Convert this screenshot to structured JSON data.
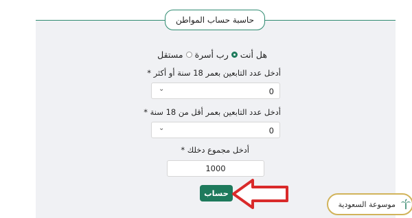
{
  "form": {
    "title": "حاسبة حساب المواطن",
    "question": "هل أنت",
    "options": [
      {
        "label": "رب أسرة",
        "checked": true
      },
      {
        "label": "مستقل",
        "checked": false
      }
    ],
    "adults_label": "أدخل عدد التابعين بعمر 18 سنة أو أكثر *",
    "adults_value": "0",
    "minors_label": "أدخل عدد التابعين بعمر أقل من 18 سنة *",
    "minors_value": "0",
    "income_label": "أدخل مجموع دخلك *",
    "income_value": "1000",
    "submit_label": "حساب"
  },
  "logo": {
    "text": "موسوعة السعودية"
  },
  "icons": {
    "chevron": "chevron-down-icon",
    "arrow": "red-arrow-icon",
    "palm": "palm-tree-icon"
  },
  "colors": {
    "accent": "#1e7a5c",
    "panel": "#f0f1f4",
    "arrow": "#d92a2a",
    "logo_border": "#d1b35a"
  }
}
